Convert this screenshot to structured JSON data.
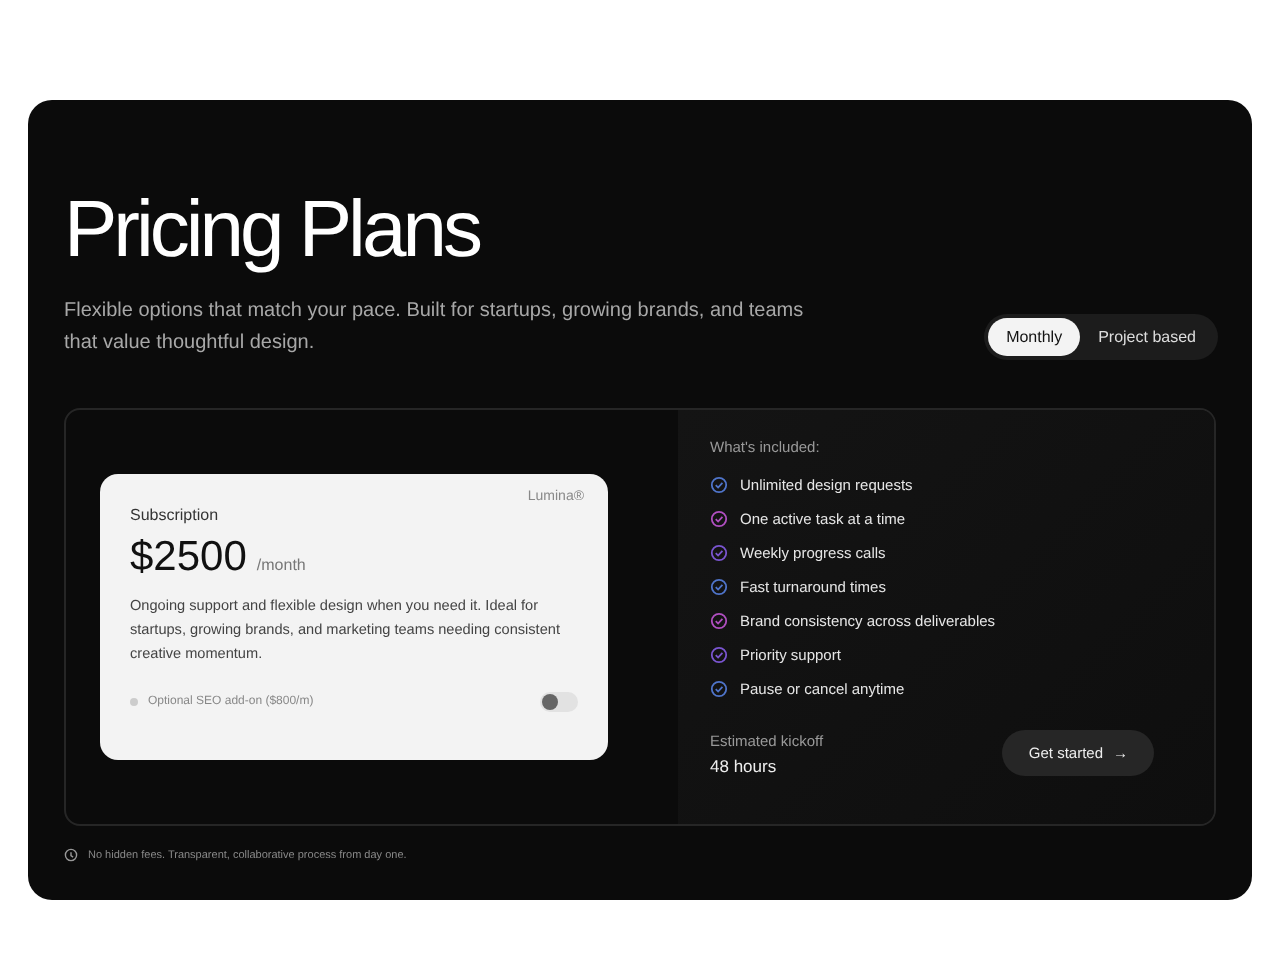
{
  "header": {
    "title": "Pricing Plans",
    "subtitle": "Flexible options that match your pace. Built for startups, growing brands, and teams that value thoughtful design."
  },
  "billing_tabs": [
    {
      "label": "Monthly",
      "selected": true
    },
    {
      "label": "Project based",
      "selected": false
    }
  ],
  "plan_card": {
    "name": "Subscription",
    "brand": "Lumina®",
    "price": "$2500",
    "period": "/month",
    "description": "Ongoing support and flexible design when you need it. Ideal for startups, growing brands, and marketing teams needing consistent creative momentum.",
    "addon": {
      "label": "Optional SEO add-on ($800/m)",
      "on": false
    }
  },
  "included": {
    "heading": "What's included:",
    "items": [
      {
        "label": "Unlimited design requests",
        "color": "#4f74c9"
      },
      {
        "label": "One active task at a time",
        "color": "#b04fc0"
      },
      {
        "label": "Weekly progress calls",
        "color": "#7a55d0"
      },
      {
        "label": "Fast turnaround times",
        "color": "#4f74c9"
      },
      {
        "label": "Brand consistency across deliverables",
        "color": "#b04fc0"
      },
      {
        "label": "Priority support",
        "color": "#7a55d0"
      },
      {
        "label": "Pause or cancel anytime",
        "color": "#4f74c9"
      }
    ]
  },
  "kickoff": {
    "label": "Estimated kickoff",
    "value": "48 hours"
  },
  "cta": {
    "label": "Get started",
    "icon": "→"
  },
  "footnote": "No hidden fees. Transparent, collaborative process from day one."
}
